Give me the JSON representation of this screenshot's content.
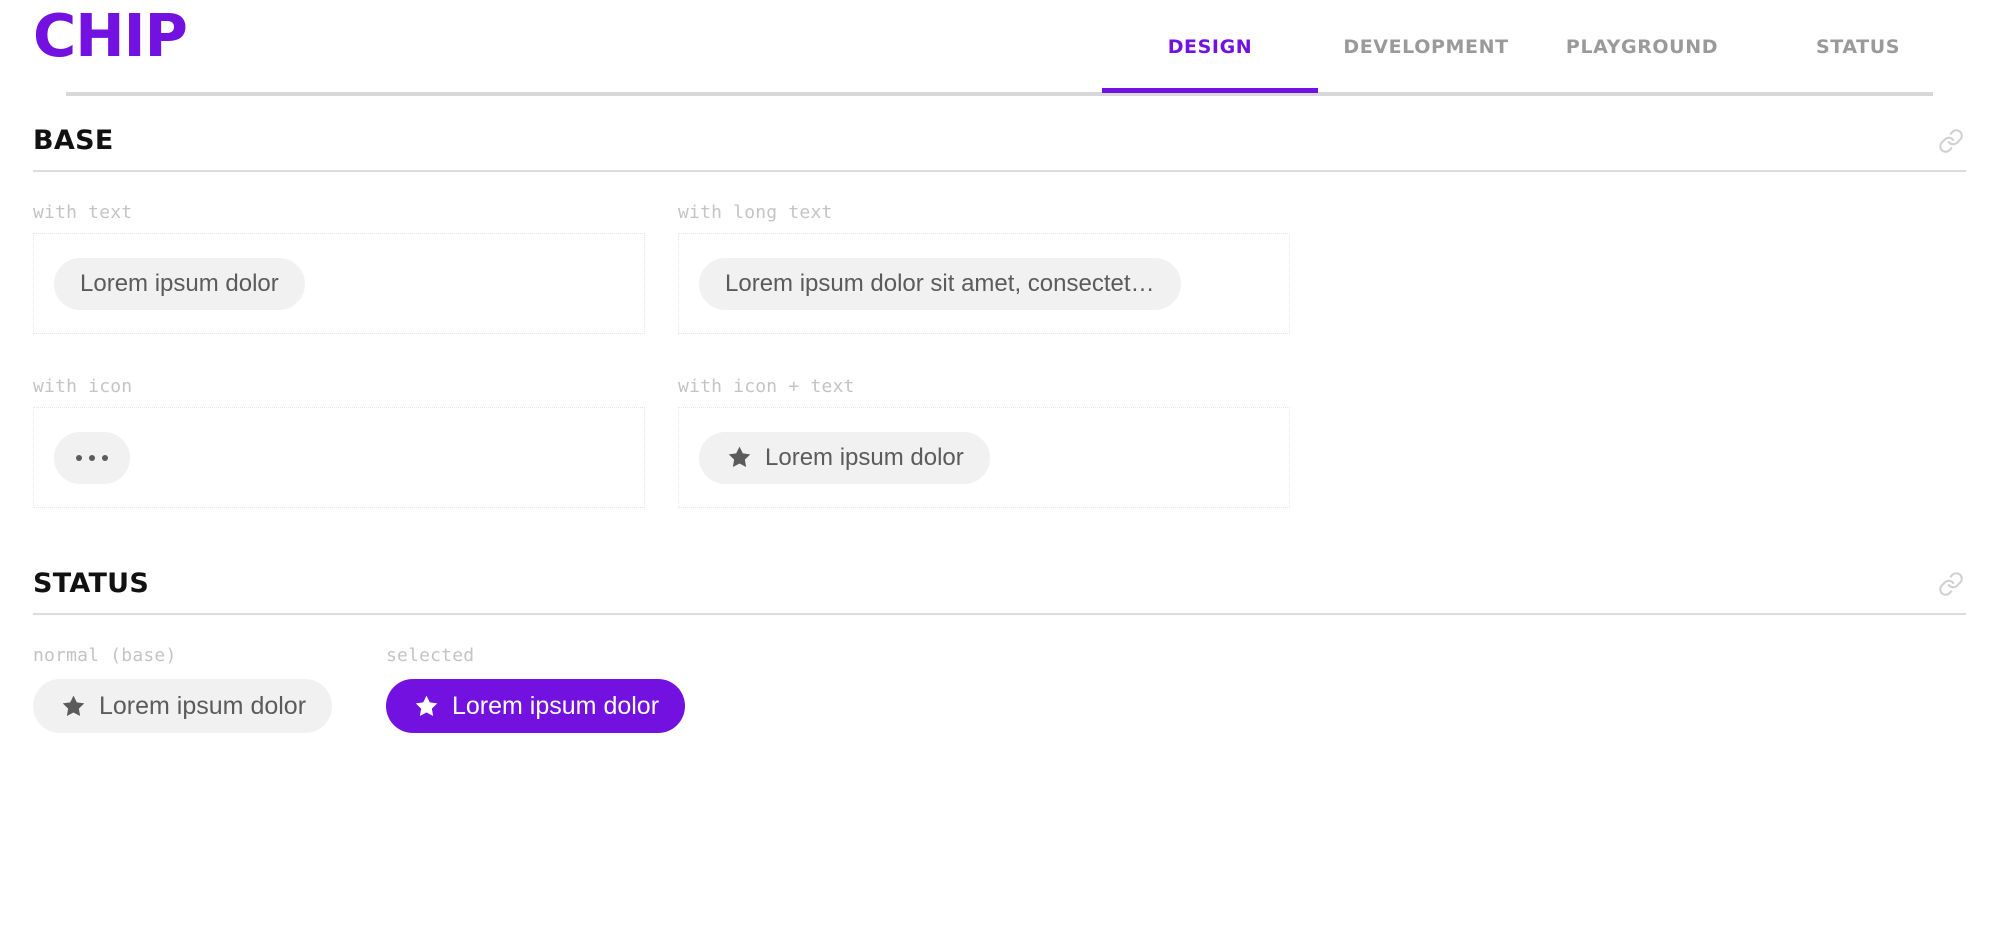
{
  "header": {
    "logo": "CHIP",
    "tabs": [
      {
        "label": "DESIGN",
        "active": true
      },
      {
        "label": "DEVELOPMENT",
        "active": false
      },
      {
        "label": "PLAYGROUND",
        "active": false
      },
      {
        "label": "STATUS",
        "active": false
      }
    ]
  },
  "colors": {
    "brand_purple": "#7211e0",
    "chip_background": "#f1f1f1",
    "chip_text": "#5b5b5b",
    "label_gray": "#c4c4c4",
    "rule_gray": "#dcdcdc"
  },
  "sections": [
    {
      "title": "BASE",
      "anchor_icon": "link-icon",
      "examples": [
        {
          "label": "with text",
          "chip_text": "Lorem ipsum dolor",
          "icon": null
        },
        {
          "label": "with long text",
          "chip_text": "Lorem ipsum dolor sit amet, consectet…",
          "icon": null
        },
        {
          "label": "with icon",
          "chip_text": "",
          "icon": "more-horizontal-icon"
        },
        {
          "label": "with icon + text",
          "chip_text": "Lorem ipsum dolor",
          "icon": "star-icon"
        }
      ]
    },
    {
      "title": "STATUS",
      "anchor_icon": "link-icon",
      "states": [
        {
          "label": "normal (base)",
          "chip_text": "Lorem ipsum dolor",
          "icon": "star-icon",
          "selected": false
        },
        {
          "label": "selected",
          "chip_text": "Lorem ipsum dolor",
          "icon": "star-icon",
          "selected": true
        }
      ]
    }
  ]
}
